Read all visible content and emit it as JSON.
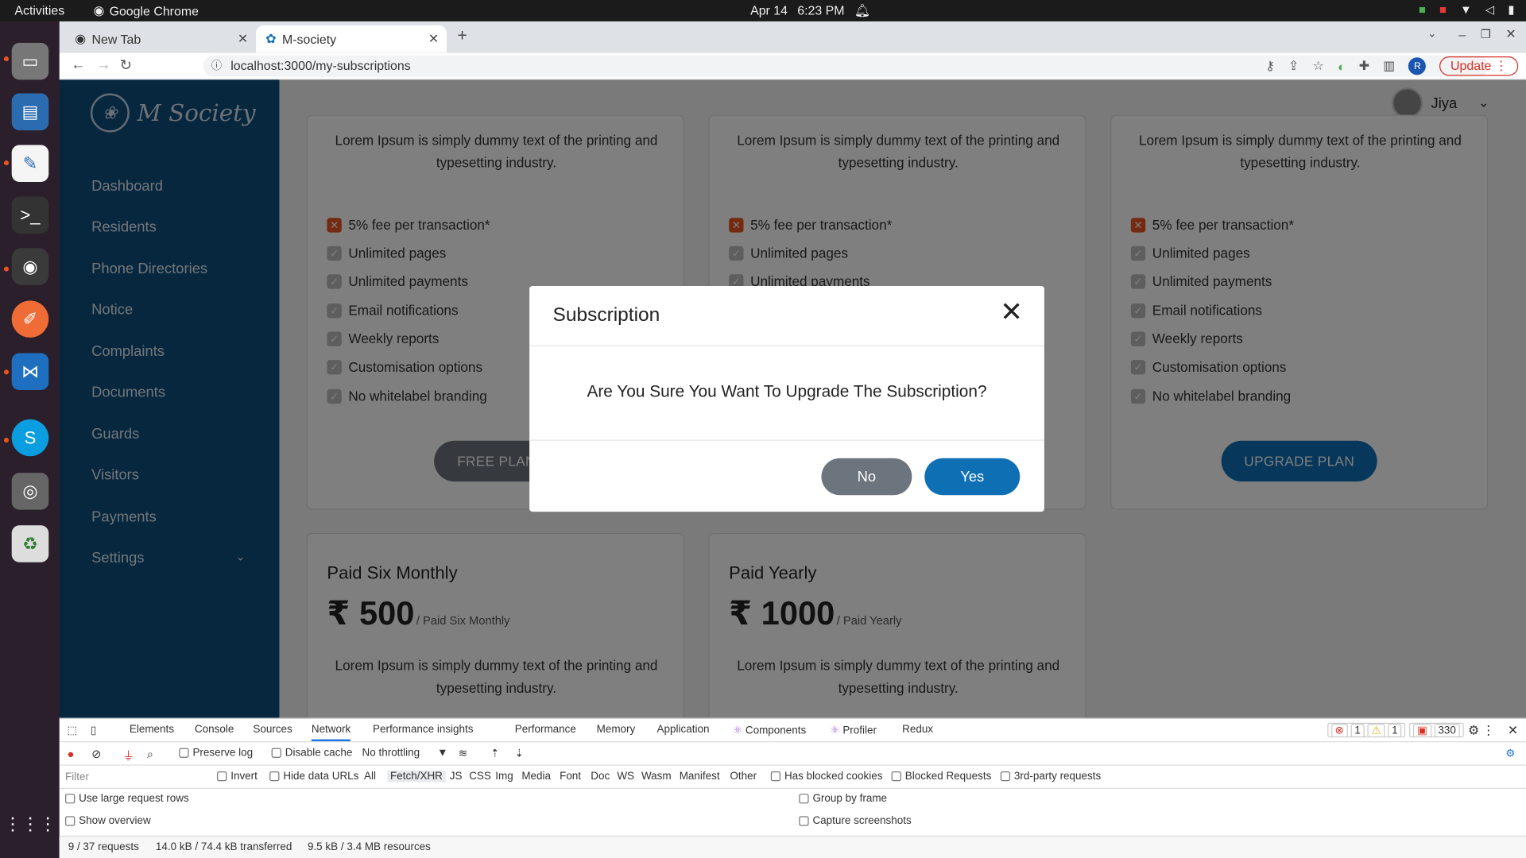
{
  "os": {
    "activities": "Activities",
    "app_name": "Google Chrome",
    "date": "Apr 14",
    "time": "6:23 PM"
  },
  "browser": {
    "tabs": [
      {
        "label": "New Tab"
      },
      {
        "label": "M-society"
      }
    ],
    "url": "localhost:3000/my-subscriptions",
    "update_label": "Update",
    "profile_initial": "R"
  },
  "app": {
    "logo_text": "M Society",
    "menu": [
      {
        "label": "Dashboard"
      },
      {
        "label": "Residents"
      },
      {
        "label": "Phone Directories"
      },
      {
        "label": "Notice"
      },
      {
        "label": "Complaints"
      },
      {
        "label": "Documents"
      },
      {
        "label": "Guards"
      },
      {
        "label": "Visitors"
      },
      {
        "label": "Payments"
      },
      {
        "label": "Settings"
      }
    ],
    "user_name": "Jiya"
  },
  "plans_top": {
    "description": "Lorem Ipsum is simply dummy text of the printing and typesetting industry.",
    "features": [
      "5% fee per transaction*",
      "Unlimited pages",
      "Unlimited payments",
      "Email notifications",
      "Weekly reports",
      "Customisation options",
      "No whitelabel branding"
    ],
    "free_plan_label": "FREE PLAN",
    "upgrade_plan_label": "UPGRADE PLAN"
  },
  "plans_bottom": [
    {
      "title": "Paid Six Monthly",
      "amount": "₹ 500",
      "period": "/ Paid Six Monthly",
      "description": "Lorem Ipsum is simply dummy text of the printing and typesetting industry."
    },
    {
      "title": "Paid Yearly",
      "amount": "₹ 1000",
      "period": "/ Paid Yearly",
      "description": "Lorem Ipsum is simply dummy text of the printing and typesetting industry."
    }
  ],
  "modal": {
    "title": "Subscription",
    "message": "Are You Sure You Want To Upgrade The Subscription?",
    "no_label": "No",
    "yes_label": "Yes"
  },
  "devtools": {
    "tabs": [
      "Elements",
      "Console",
      "Sources",
      "Network",
      "Performance insights",
      "Performance",
      "Memory",
      "Application",
      "Components",
      "Profiler",
      "Redux"
    ],
    "active_tab": "Network",
    "errors": "1",
    "warnings": "1",
    "issues": "330",
    "preserve_log": "Preserve log",
    "disable_cache": "Disable cache",
    "throttling": "No throttling",
    "filter_placeholder": "Filter",
    "invert": "Invert",
    "hide_data_urls": "Hide data URLs",
    "type_filters": [
      "All",
      "Fetch/XHR",
      "JS",
      "CSS",
      "Img",
      "Media",
      "Font",
      "Doc",
      "WS",
      "Wasm",
      "Manifest",
      "Other"
    ],
    "has_blocked_cookies": "Has blocked cookies",
    "blocked_requests": "Blocked Requests",
    "third_party": "3rd-party requests",
    "large_rows": "Use large request rows",
    "show_overview": "Show overview",
    "group_by_frame": "Group by frame",
    "capture_screenshots": "Capture screenshots",
    "summary_requests": "9 / 37 requests",
    "summary_transferred": "14.0 kB / 74.4 kB transferred",
    "summary_resources": "9.5 kB / 3.4 MB resources"
  }
}
